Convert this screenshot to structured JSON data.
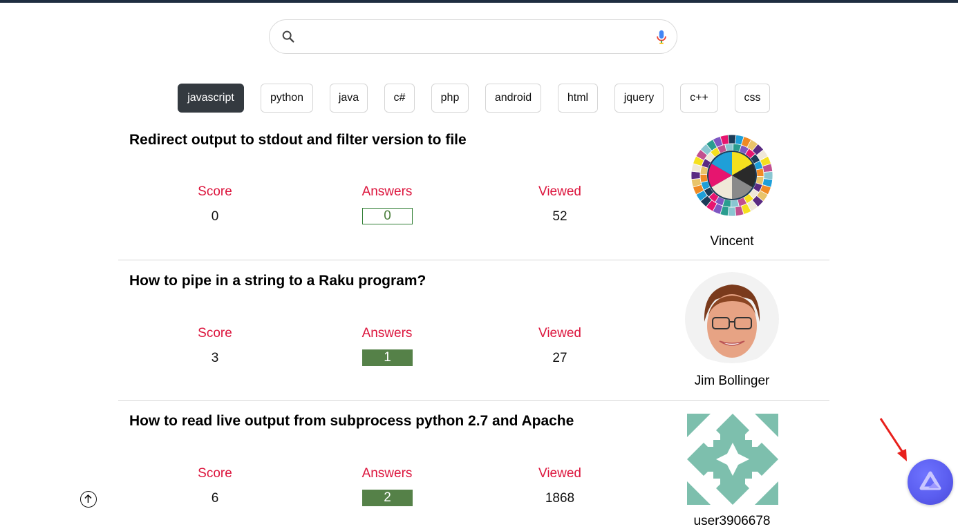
{
  "search": {
    "value": "",
    "placeholder": ""
  },
  "tags": [
    "javascript",
    "python",
    "java",
    "c#",
    "php",
    "android",
    "html",
    "jquery",
    "c++",
    "css"
  ],
  "active_tag": "javascript",
  "labels": {
    "score": "Score",
    "answers": "Answers",
    "viewed": "Viewed"
  },
  "questions": [
    {
      "title": "Redirect output to stdout and filter version to file",
      "score": "0",
      "answers": "0",
      "viewed": "52",
      "user": "Vincent"
    },
    {
      "title": "How to pipe in a string to a Raku program?",
      "score": "3",
      "answers": "1",
      "viewed": "27",
      "user": "Jim Bollinger"
    },
    {
      "title": "How to read live output from subprocess python 2.7 and Apache",
      "score": "6",
      "answers": "2",
      "viewed": "1868",
      "user": "user3906678"
    }
  ],
  "colors": {
    "accent_label": "#dc143c",
    "answered_bg": "#558148",
    "active_tag_bg": "#343a40",
    "fab_bg": "#5b5ef0",
    "top_bar": "#1e2d40"
  },
  "icons": [
    "search-icon",
    "mic-icon",
    "scroll-top-icon",
    "assistant-logo-icon",
    "red-arrow-annotation"
  ]
}
